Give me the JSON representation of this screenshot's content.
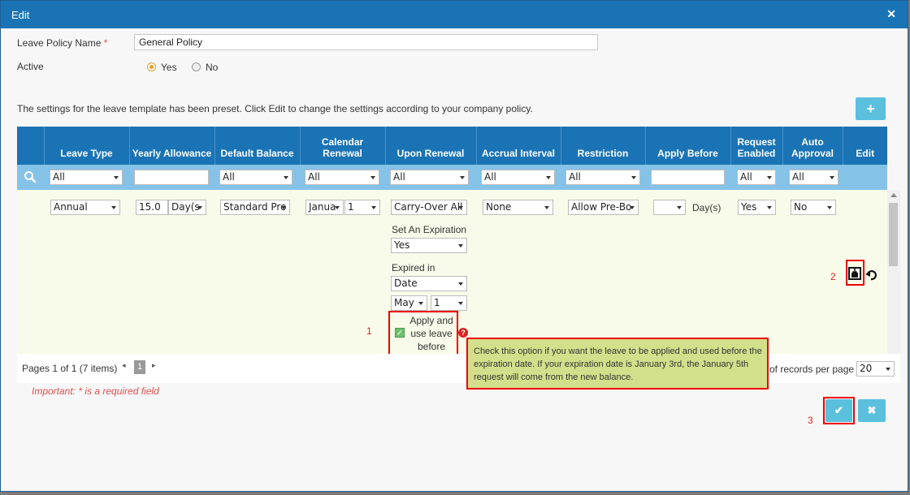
{
  "dialog": {
    "title": "Edit",
    "close_icon": "close-icon"
  },
  "form": {
    "policy_label": "Leave Policy Name",
    "required_mark": "*",
    "policy_value": "General Policy",
    "active_label": "Active",
    "yes_label": "Yes",
    "no_label": "No",
    "active_value": "Yes"
  },
  "info_text": "The settings for the leave template has been preset. Click Edit to change the settings according to your company policy.",
  "add_icon": "plus-icon",
  "table": {
    "headers": [
      "",
      "Leave Type",
      "Yearly Allowance",
      "Default Balance",
      "Calendar Renewal",
      "Upon Renewal",
      "Accrual Interval",
      "Restriction",
      "Apply Before",
      "Request Enabled",
      "Auto Approval",
      "Edit"
    ],
    "filters": {
      "leave_type": "All",
      "default_balance": "All",
      "calendar_renewal": "All",
      "upon_renewal": "All",
      "accrual_interval": "All",
      "restriction": "All",
      "request_enabled": "All",
      "auto_approval": "All"
    },
    "row": {
      "leave_type": "Annual",
      "allowance": "15.0",
      "allowance_unit": "Day(s",
      "default_balance": "Standard Pro",
      "renewal_month": "Janua",
      "renewal_day": "1",
      "upon_renewal": "Carry-Over All",
      "set_expiration_label": "Set An Expiration",
      "set_expiration_value": "Yes",
      "expired_in_label": "Expired in",
      "expired_in_value": "Date",
      "exp_month": "May",
      "exp_day": "1",
      "apply_use_label": "Apply and use leave before",
      "accrual": "None",
      "restriction": "Allow Pre-Bo",
      "apply_before_unit": "Day(s)",
      "request_enabled": "Yes",
      "auto_approval": "No"
    }
  },
  "tooltip": "Check this option if you want the leave to be applied and used before the expiration date. If your expiration date is January 3rd, the January 5th request will come from the new balance.",
  "annotations": {
    "one": "1",
    "two": "2",
    "three": "3"
  },
  "pager": {
    "info": "Pages 1 of 1 (7 items)",
    "current_page": "1",
    "per_page_label": "of records per page",
    "per_page_value": "20"
  },
  "important_note": "Important: * is a required field",
  "colors": {
    "header": "#1a73b5",
    "filter_row": "#85c2e8",
    "row_bg": "#f8fbe9",
    "accent_button": "#5bc0de",
    "highlight": "#e00000"
  }
}
